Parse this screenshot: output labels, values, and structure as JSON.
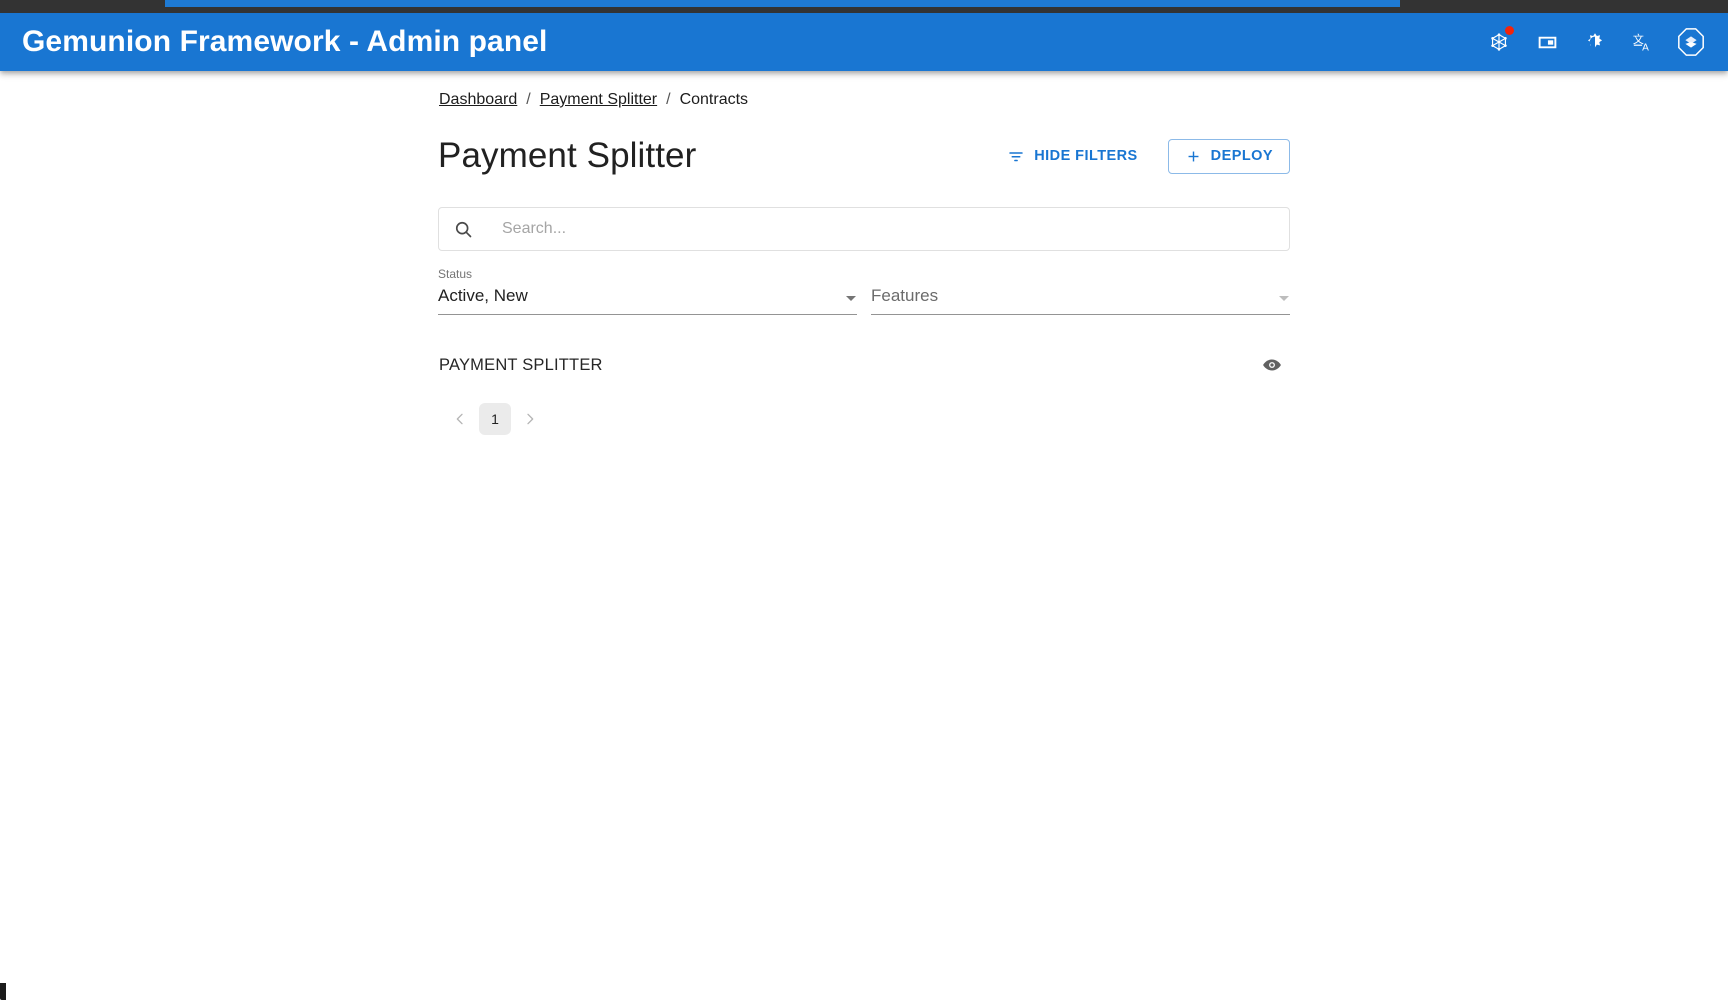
{
  "appbar": {
    "title": "Gemunion Framework - Admin panel",
    "background_color": "#1976d2",
    "actions": [
      {
        "name": "network-icon",
        "label": "Network",
        "has_badge": true
      },
      {
        "name": "wallet-icon",
        "label": "Wallet",
        "has_badge": false
      },
      {
        "name": "theme-toggle-icon",
        "label": "Theme",
        "has_badge": false
      },
      {
        "name": "language-icon",
        "label": "Language",
        "has_badge": false
      },
      {
        "name": "app-logo-icon",
        "label": "Gemunion",
        "has_badge": false
      }
    ]
  },
  "breadcrumb": {
    "items": [
      {
        "label": "Dashboard",
        "is_link": true
      },
      {
        "label": "Payment Splitter",
        "is_link": true
      },
      {
        "label": "Contracts",
        "is_link": false
      }
    ],
    "separator": "/"
  },
  "header": {
    "title": "Payment Splitter",
    "hide_filters_label": "HIDE FILTERS",
    "deploy_label": "DEPLOY",
    "deploy_prefix": "+",
    "accent_color": "#1976d2"
  },
  "search": {
    "value": "",
    "placeholder": "Search..."
  },
  "filters": [
    {
      "name": "status",
      "label": "Status",
      "value": "Active, New",
      "placeholder": "",
      "has_value": true
    },
    {
      "name": "features",
      "label": "Features",
      "value": "",
      "placeholder": "Features",
      "has_value": false
    }
  ],
  "list": {
    "items": [
      {
        "title": "PAYMENT SPLITTER",
        "action_icon": "eye-icon"
      }
    ]
  },
  "pagination": {
    "prev_label": "‹",
    "next_label": "›",
    "pages": [
      "1"
    ],
    "current": "1"
  }
}
